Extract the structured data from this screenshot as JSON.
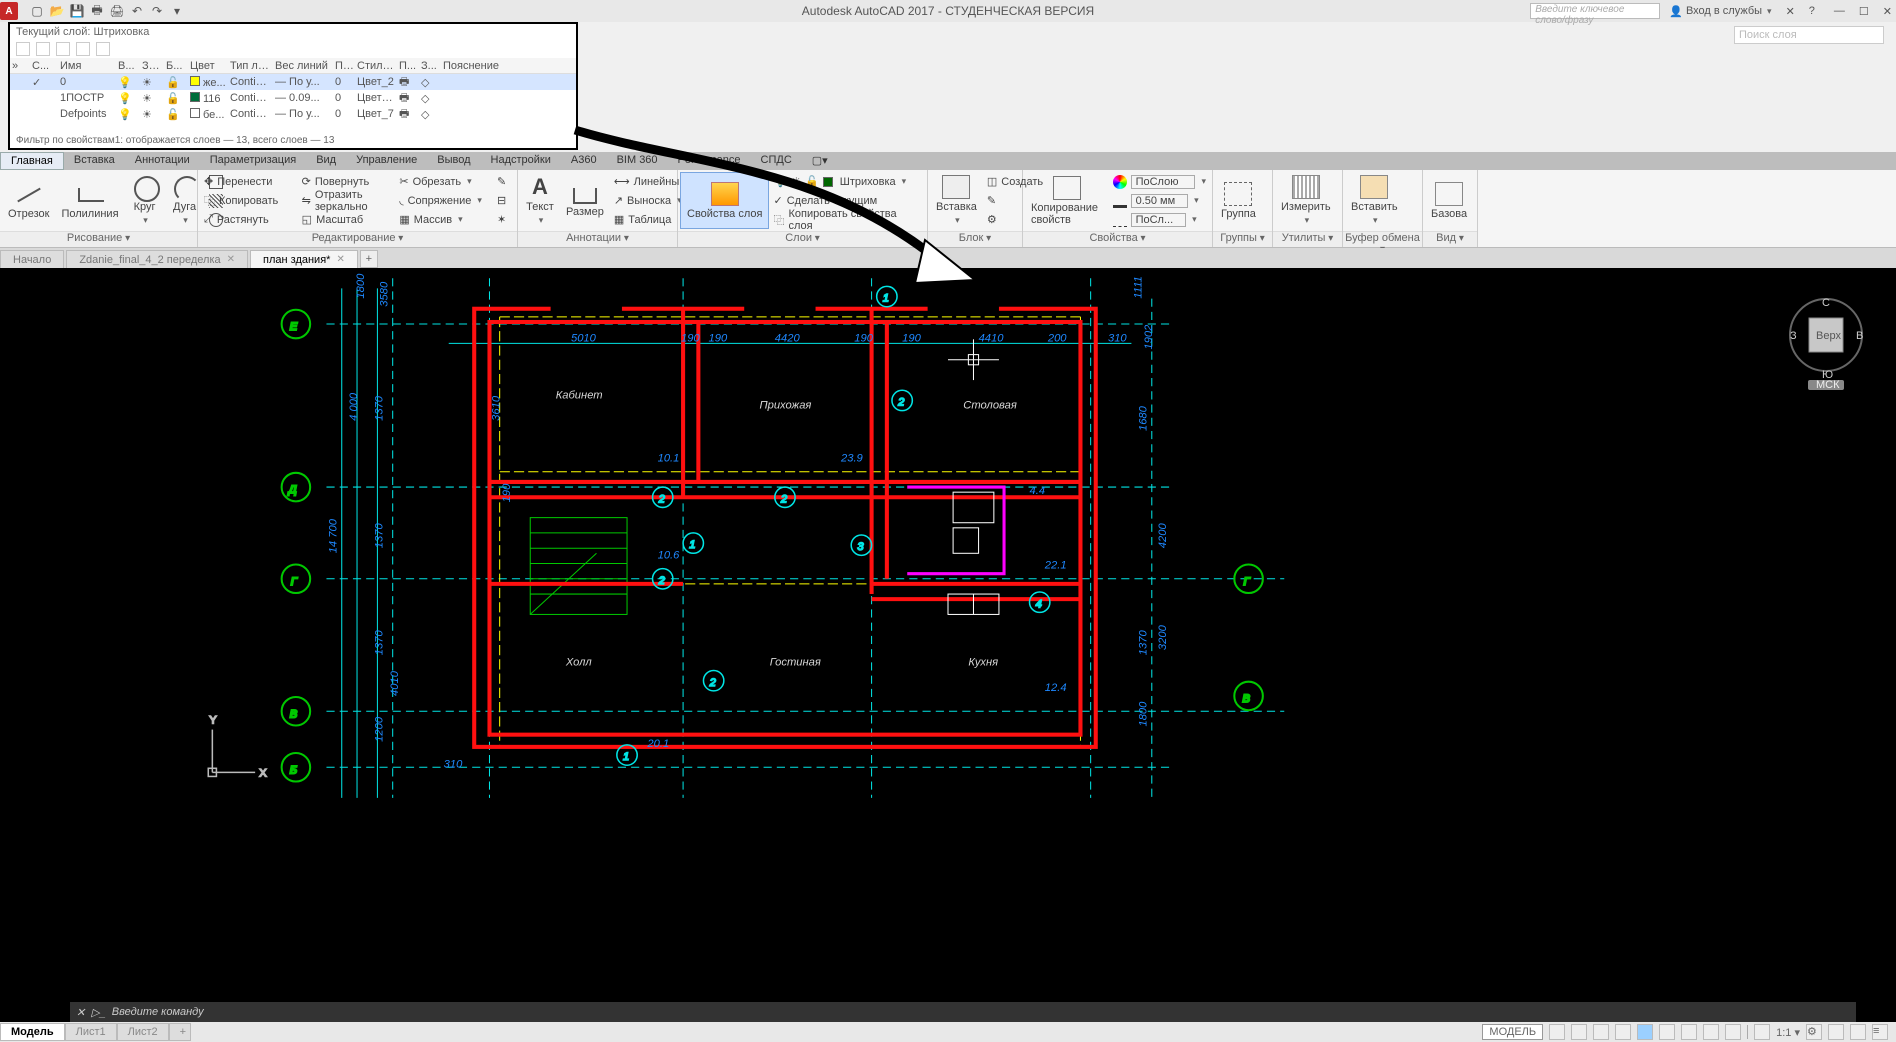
{
  "app": {
    "title": "Autodesk AutoCAD 2017 - СТУДЕНЧЕСКАЯ ВЕРСИЯ"
  },
  "search_placeholder": "Введите ключевое слово/фразу",
  "signin": "Вход в службы",
  "layer_search_placeholder": "Поиск слоя",
  "layer_panel": {
    "current": "Текущий слой: Штриховка",
    "filter_foot": "Фильтр по свойствам1: отображается слоев — 13, всего слоев — 13",
    "headers": {
      "s": "С...",
      "name": "Имя",
      "on": "В...",
      "frz": "За...",
      "lck": "Б...",
      "color": "Цвет",
      "ltype": "Тип ли...",
      "lwt": "Вес линий",
      "trn": "Проз...",
      "style": "Стиль...",
      "p": "П...",
      "z": "З...",
      "desc": "Пояснение"
    },
    "rows": [
      {
        "name": "0",
        "color": "же...",
        "swatch": "#ffff00",
        "ltype": "Continu...",
        "lwt": "— По у...",
        "trn": "0",
        "style": "Цвет_2"
      },
      {
        "name": "1ПОСТР",
        "color": "116",
        "swatch": "#006d3a",
        "ltype": "Continu...",
        "lwt": "— 0.09...",
        "trn": "0",
        "style": "Цвет_1..."
      },
      {
        "name": "Defpoints",
        "color": "бе...",
        "swatch": "#ffffff",
        "ltype": "Continu...",
        "lwt": "— По у...",
        "trn": "0",
        "style": "Цвет_7"
      }
    ]
  },
  "menus": [
    "Главная",
    "Вставка",
    "Аннотации",
    "Параметризация",
    "Вид",
    "Управление",
    "Вывод",
    "Надстройки",
    "A360",
    "BIM 360",
    "Performance",
    "СПДС"
  ],
  "ribbon": {
    "draw": {
      "title": "Рисование",
      "btns": {
        "seg": "Отрезок",
        "poly": "Полилиния",
        "circ": "Круг",
        "arc": "Дуга"
      }
    },
    "edit": {
      "title": "Редактирование",
      "items": [
        "Перенести",
        "Повернуть",
        "Обрезать",
        "Копировать",
        "Отразить зеркально",
        "Сопряжение",
        "Растянуть",
        "Масштаб",
        "Массив"
      ]
    },
    "annot": {
      "title": "Аннотации",
      "btns": {
        "text": "Текст",
        "dim": "Размер"
      },
      "items": [
        "Линейный",
        "Выноска",
        "Таблица"
      ]
    },
    "layers": {
      "title": "Слои",
      "prop": "Свойства слоя",
      "items": [
        "Штриховка",
        "Сделать текущим",
        "Копировать свойства слоя"
      ]
    },
    "block": {
      "title": "Блок",
      "btns": {
        "ins": "Вставка"
      },
      "items": [
        "Создать",
        "Редактировать",
        "Редактировать атрибуты"
      ]
    },
    "props": {
      "title": "Свойства",
      "copy": "Копирование свойств",
      "layer_sel": "ПоСлою",
      "lwt": "0.50 мм",
      "lt": "ПоСл..."
    },
    "groups": {
      "title": "Группы",
      "btn": "Группа"
    },
    "util": {
      "title": "Утилиты",
      "btn": "Измерить"
    },
    "clip": {
      "title": "Буфер обмена",
      "btn": "Вставить"
    },
    "view": {
      "title": "Вид",
      "btn": "Базова"
    }
  },
  "doc_tabs": [
    {
      "label": "Начало"
    },
    {
      "label": "Zdanie_final_4_2 переделка"
    },
    {
      "label": "план здания*",
      "active": true
    }
  ],
  "cmd_placeholder": "Введите команду",
  "status": {
    "tabs": [
      "Модель",
      "Лист1",
      "Лист2"
    ],
    "btn": "МОДЕЛЬ"
  },
  "viewcube": {
    "top": "Верх",
    "n": "С",
    "s": "Ю",
    "e": "В",
    "w": "З",
    "wcs": "МСК"
  },
  "drawing": {
    "rooms": {
      "kabinet": "Кабинет",
      "prihoz": "Прихожая",
      "stol": "Столовая",
      "holl": "Холл",
      "gost": "Гостиная",
      "kuhnya": "Кухня"
    },
    "axes": {
      "E": "Е",
      "D": "Д",
      "G": "Г",
      "V": "В",
      "B": "Б",
      "G2": "Г",
      "V2": "В"
    },
    "marks": {
      "m1": "1",
      "m2": "2",
      "m3": "3",
      "m4": "4"
    },
    "dims": {
      "d1800": "1800",
      "d3580": "3580",
      "d4000": "4 000",
      "d1370": "1370",
      "d14700": "14 700",
      "d1200": "1200",
      "d310": "310",
      "d3610": "3610",
      "d190": "190",
      "d5010": "5010",
      "d4420": "4420",
      "d4410": "4410",
      "d200": "200",
      "d1902": "1902",
      "d4200": "4200",
      "d3200": "3200",
      "d1680": "1680",
      "d1111": "1111",
      "a101": "10.1",
      "a239": "23.9",
      "a106": "10.6",
      "a44": "4.4",
      "a221": "22.1",
      "a124": "12.4",
      "a201": "20.1",
      "d4010": "4010"
    }
  }
}
